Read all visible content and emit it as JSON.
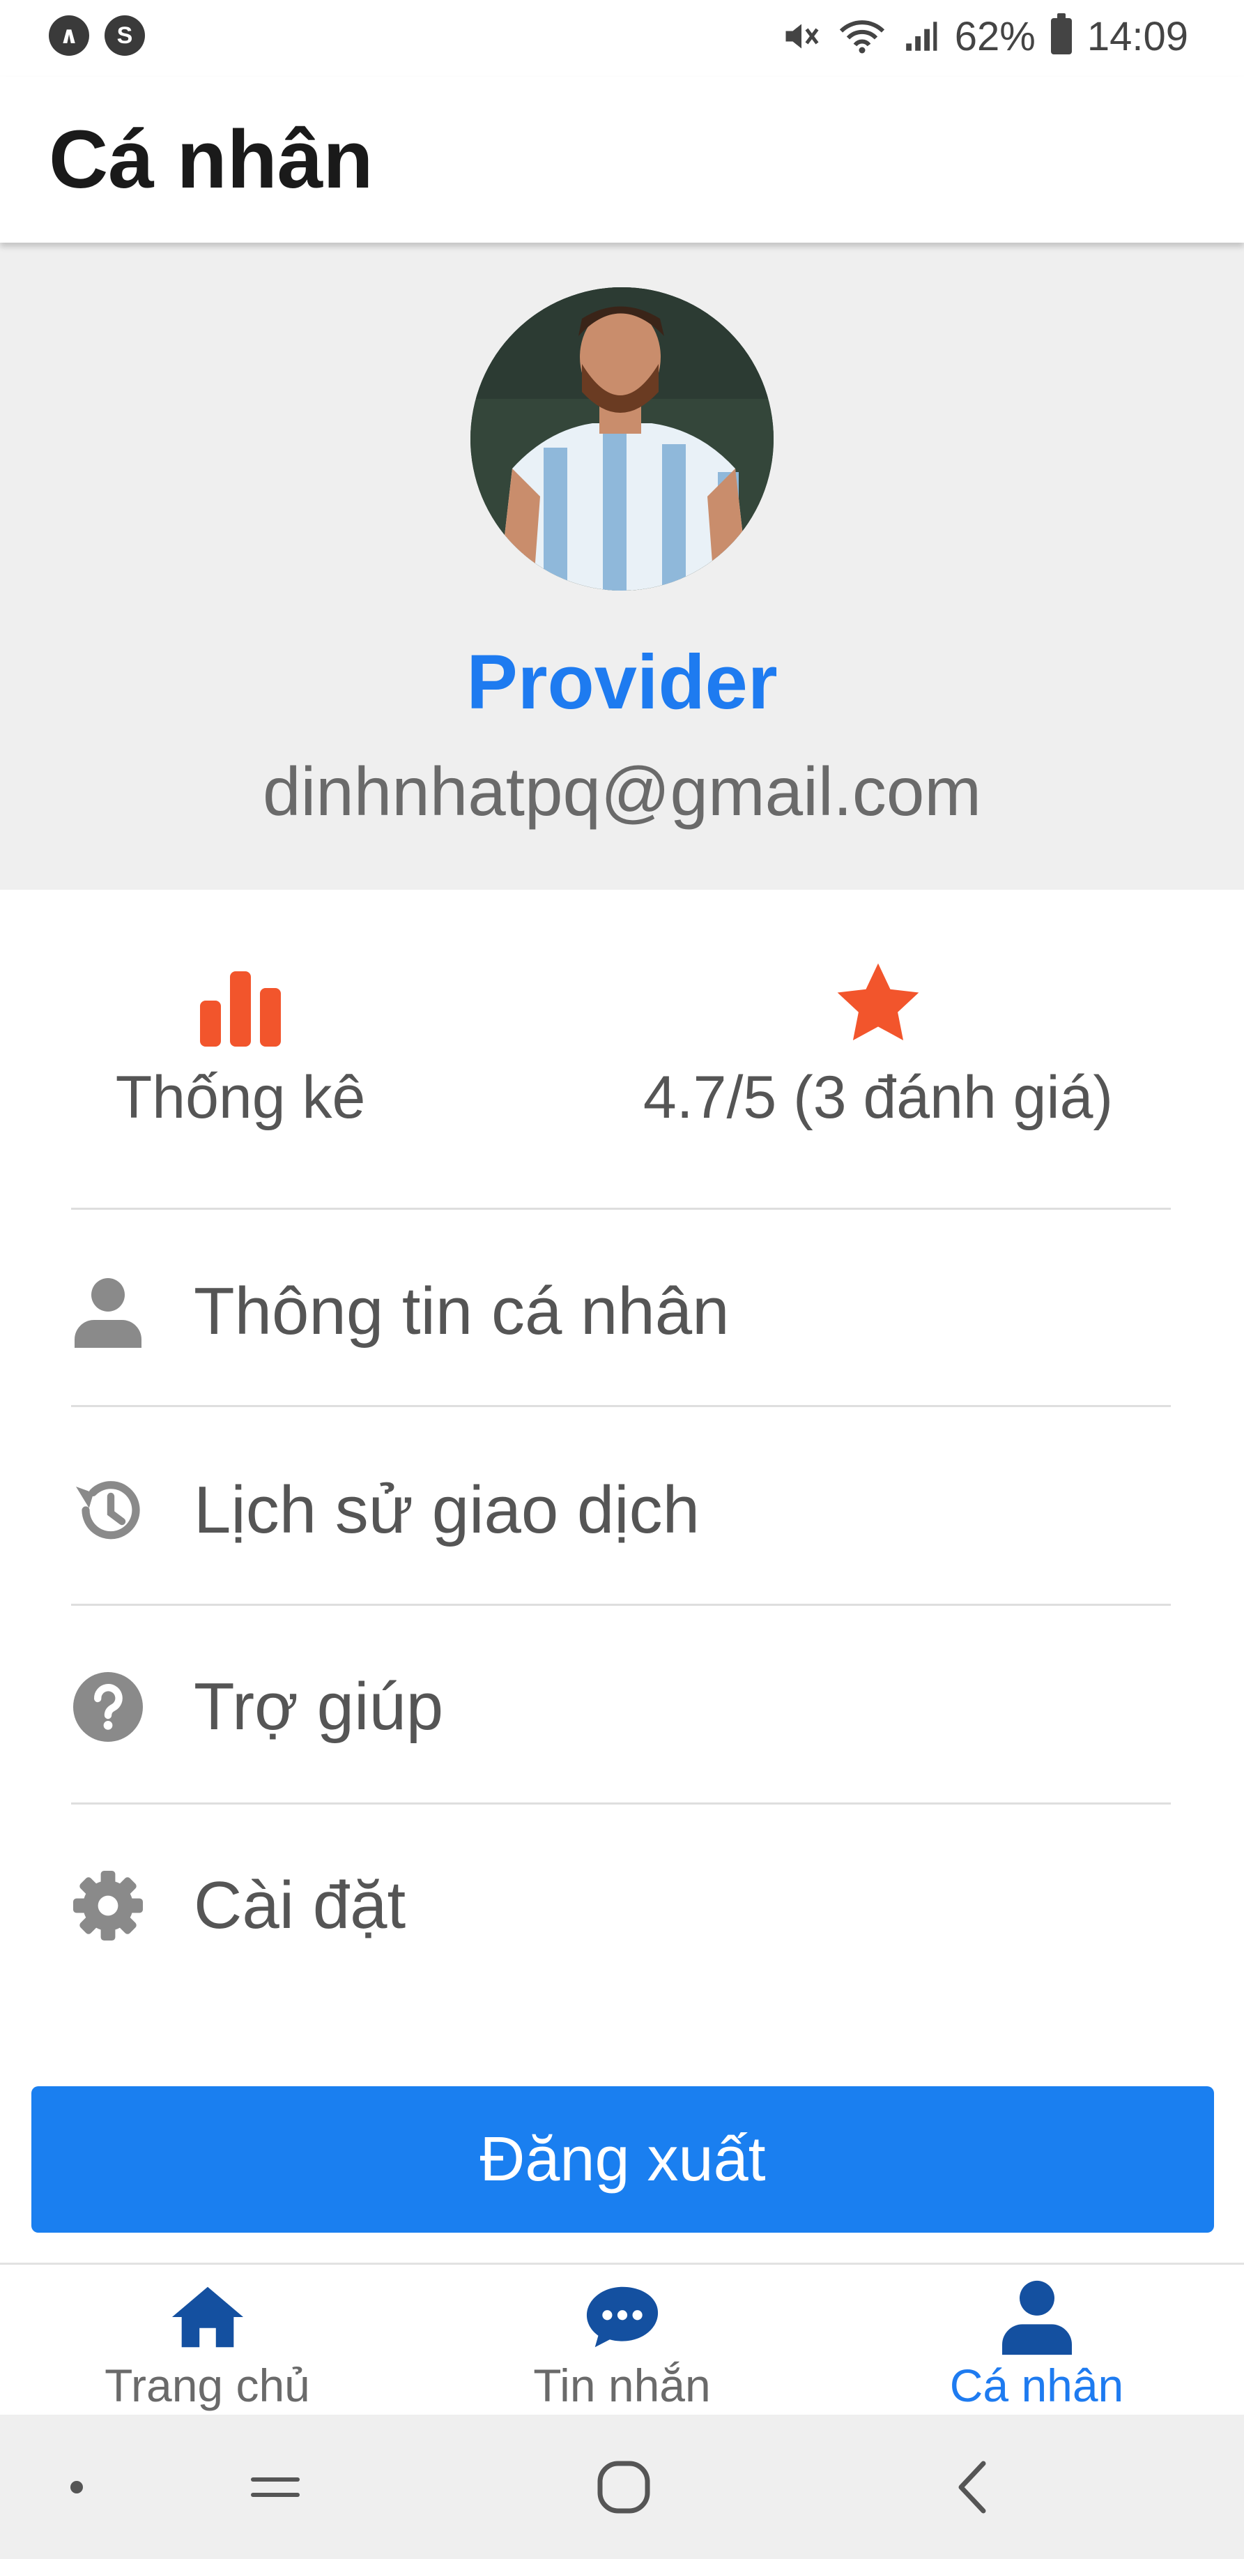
{
  "status_bar": {
    "left_icons": [
      "app-icon-a",
      "app-icon-s"
    ],
    "battery_percent": "62%",
    "time": "14:09"
  },
  "header": {
    "title": "Cá nhân"
  },
  "profile": {
    "name": "Provider",
    "email": "dinhnhatpq@gmail.com"
  },
  "stats": {
    "statistics_label": "Thống kê",
    "rating_label": "4.7/5 (3 đánh giá)"
  },
  "menu": {
    "items": [
      {
        "label": "Thông tin cá nhân",
        "icon": "user-icon"
      },
      {
        "label": "Lịch sử giao dịch",
        "icon": "history-icon"
      },
      {
        "label": "Trợ giúp",
        "icon": "help-icon"
      },
      {
        "label": "Cài đặt",
        "icon": "gear-icon"
      }
    ]
  },
  "logout": {
    "label": "Đăng xuất"
  },
  "bottom_nav": {
    "items": [
      {
        "label": "Trang chủ",
        "icon": "home-icon",
        "active": false
      },
      {
        "label": "Tin nhắn",
        "icon": "chat-icon",
        "active": false
      },
      {
        "label": "Cá nhân",
        "icon": "user-icon",
        "active": true
      }
    ]
  },
  "colors": {
    "accent": "#1e7bf0",
    "stat_icon": "#f2552c",
    "nav_icon": "#1450a0",
    "text_gray": "#555555"
  }
}
